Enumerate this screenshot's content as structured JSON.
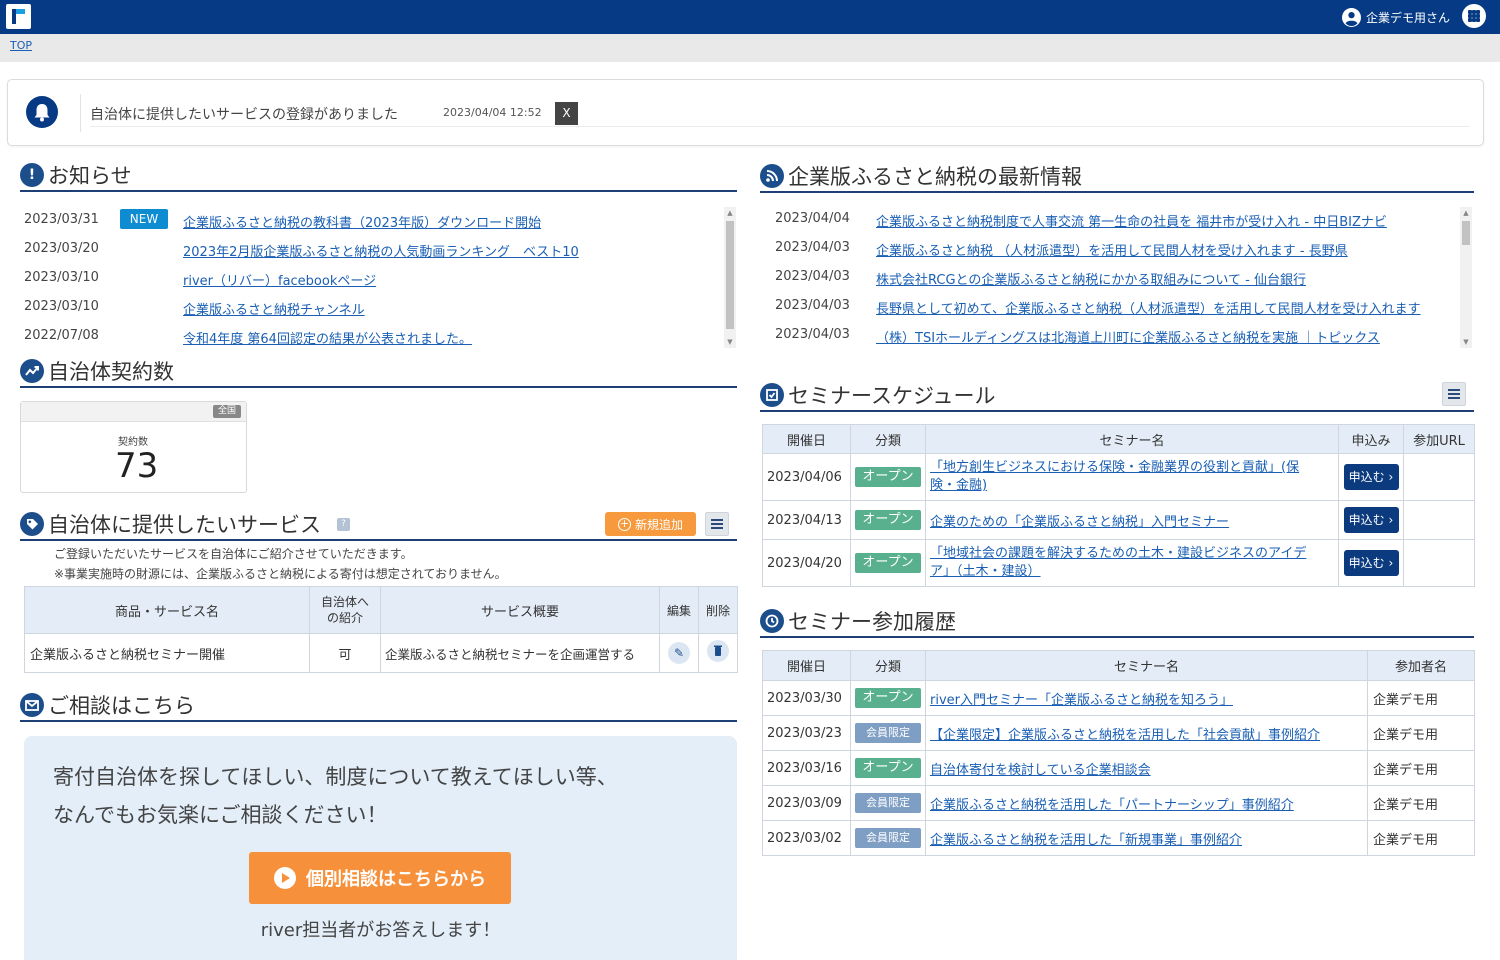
{
  "header": {
    "user_name": "企業デモ用さん",
    "breadcrumb": "TOP"
  },
  "notification": {
    "message": "自治体に提供したいサービスの登録がありました",
    "time": "2023/04/04 12:52",
    "close_label": "X"
  },
  "news": {
    "title": "お知らせ",
    "new_label": "NEW",
    "items": [
      {
        "date": "2023/03/31",
        "title": "企業版ふるさと納税の教科書（2023年版）ダウンロード開始"
      },
      {
        "date": "2023/03/20",
        "title": "2023年2月版企業版ふるさと納税の人気動画ランキング　ベスト10"
      },
      {
        "date": "2023/03/10",
        "title": "river（リバー）facebookページ"
      },
      {
        "date": "2023/03/10",
        "title": "企業版ふるさと納税チャンネル"
      },
      {
        "date": "2022/07/08",
        "title": "令和4年度 第64回認定の結果が公表されました。"
      }
    ]
  },
  "latest": {
    "title": "企業版ふるさと納税の最新情報",
    "items": [
      {
        "date": "2023/04/04",
        "title": "企業版ふるさと納税制度で人事交流 第一生命の社員を 福井市が受け入れ - 中日BIZナビ"
      },
      {
        "date": "2023/04/03",
        "title": "企業版ふるさと納税 （人材派遣型）を活用して民間人材を受け入れます - 長野県"
      },
      {
        "date": "2023/04/03",
        "title": "株式会社RCGとの企業版ふるさと納税にかかる取組みについて - 仙台銀行"
      },
      {
        "date": "2023/04/03",
        "title": "長野県として初めて、企業版ふるさと納税（人材派遣型）を活用して民間人材を受け入れます"
      },
      {
        "date": "2023/04/03",
        "title": "（株）TSIホールディングスは北海道上川町に企業版ふるさと納税を実施 ｜トピックス"
      }
    ]
  },
  "contracts": {
    "title": "自治体契約数",
    "scope": "全国",
    "label": "契約数",
    "value": "73"
  },
  "services": {
    "title": "自治体に提供したいサービス",
    "help_icon": "?",
    "add_label": "新規追加",
    "note1": "ご登録いただいたサービスを自治体にご紹介させていただきます。",
    "note2": "※事業実施時の財源には、企業版ふるさと納税による寄付は想定されておりません。",
    "columns": [
      "商品・サービス名",
      "自治体へ",
      "の紹介",
      "サービス概要",
      "編集",
      "削除"
    ],
    "rows": [
      {
        "name": "企業版ふるさと納税セミナー開催",
        "intro": "可",
        "summary": "企業版ふるさと納税セミナーを企画運営する"
      }
    ]
  },
  "consult": {
    "title": "ご相談はこちら",
    "line1": "寄付自治体を探してほしい、制度について教えてほしい等、",
    "line2": "なんでもお気楽にご相談ください！",
    "button": "個別相談はこちらから",
    "sub": "river担当者がお答えします！"
  },
  "schedule": {
    "title": "セミナースケジュール",
    "columns": [
      "開催日",
      "分類",
      "セミナー名",
      "申込み",
      "参加URL"
    ],
    "apply_label": "申込む",
    "rows": [
      {
        "date": "2023/04/06",
        "category": "オープン",
        "name1": "「地方創生ビジネスにおける保険・金融業界の役割と貢献」(保",
        "name2": "険・金融)"
      },
      {
        "date": "2023/04/13",
        "category": "オープン",
        "name1": "企業のための「企業版ふるさと納税」入門セミナー",
        "name2": ""
      },
      {
        "date": "2023/04/20",
        "category": "オープン",
        "name1": "「地域社会の課題を解決するための土木・建設ビジネスのアイデ",
        "name2": "ア」（土木・建設）"
      }
    ]
  },
  "history": {
    "title": "セミナー参加履歴",
    "columns": [
      "開催日",
      "分類",
      "セミナー名",
      "参加者名"
    ],
    "rows": [
      {
        "date": "2023/03/30",
        "category": "オープン",
        "cat_type": "open",
        "name": "river入門セミナー「企業版ふるさと納税を知ろう」",
        "participant": "企業デモ用"
      },
      {
        "date": "2023/03/23",
        "category": "会員限定",
        "cat_type": "member",
        "name": "【企業限定】企業版ふるさと納税を活用した「社会貢献」事例紹介",
        "participant": "企業デモ用"
      },
      {
        "date": "2023/03/16",
        "category": "オープン",
        "cat_type": "open",
        "name": "自治体寄付を検討している企業相談会",
        "participant": "企業デモ用"
      },
      {
        "date": "2023/03/09",
        "category": "会員限定",
        "cat_type": "member",
        "name": "企業版ふるさと納税を活用した「パートナーシップ」事例紹介",
        "participant": "企業デモ用"
      },
      {
        "date": "2023/03/02",
        "category": "会員限定",
        "cat_type": "member",
        "name": "企業版ふるさと納税を活用した「新規事業」事例紹介",
        "participant": "企業デモ用"
      }
    ]
  },
  "colors": {
    "navy": "#073a84",
    "accent_orange": "#f79a3e",
    "open_green": "#59b08f",
    "member_blue": "#7f9ec4"
  }
}
